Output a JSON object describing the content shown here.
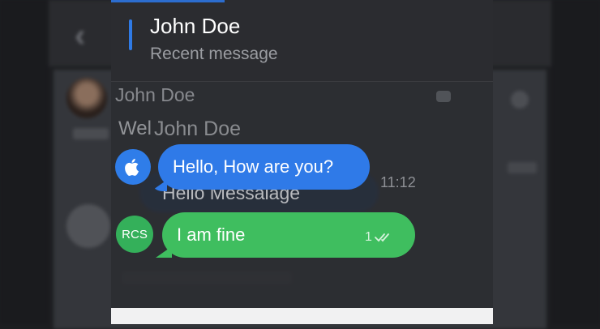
{
  "header": {
    "title": "John Doe",
    "subtitle": "Recent message"
  },
  "background": {
    "contact_name": "John Doe",
    "preview_prefix": "Wel",
    "preview_name": "John Doe",
    "preview_message": "Hello Messalage"
  },
  "messages": [
    {
      "avatar_icon": "apple-icon",
      "text": "Hello, How are you?",
      "time": "11:12",
      "color": "#2f7ae8"
    },
    {
      "avatar_label": "RCS",
      "text": "I am fine",
      "time": "1",
      "status_icon": "double-check-icon",
      "color": "#3fbe5f"
    }
  ],
  "colors": {
    "accent_blue": "#2f7ae5",
    "rcs_green": "#34b05a"
  }
}
